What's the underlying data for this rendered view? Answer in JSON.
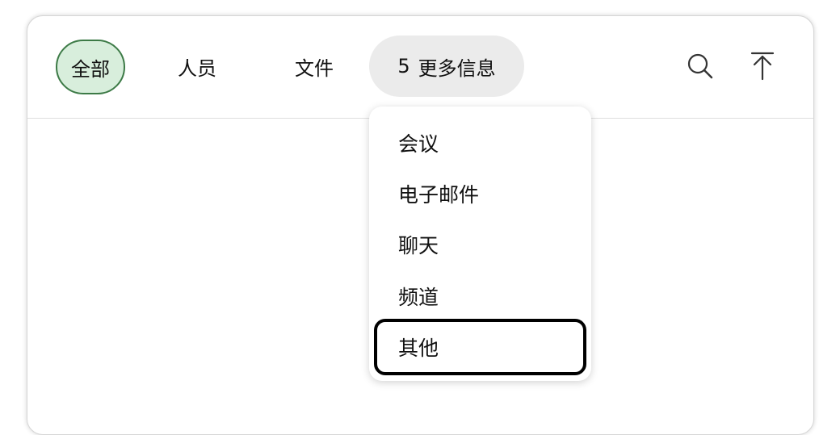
{
  "tabs": {
    "all": "全部",
    "people": "人员",
    "files": "文件",
    "more_count": "5",
    "more_label": "更多信息"
  },
  "icons": {
    "search": "search-icon",
    "scroll_top": "scroll-to-top-icon"
  },
  "dropdown": {
    "items": [
      "会议",
      "电子邮件",
      "聊天",
      "频道",
      "其他"
    ],
    "focused_item": "其他"
  },
  "colors": {
    "selected_tab_bg": "#d8eedc",
    "selected_tab_border": "#3c7a46",
    "more_tab_bg": "#ebebeb",
    "focus_ring": "#000000"
  }
}
